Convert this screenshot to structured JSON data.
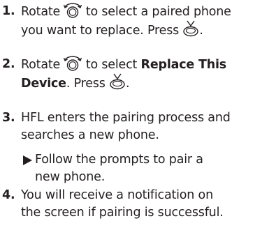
{
  "steps": [
    {
      "number": "1.",
      "line1_before": "Rotate",
      "line1_after": "to select a paired phone",
      "line2_before": "you want to replace. Press",
      "line2_after": ".",
      "icons": [
        "interface-dial-rotate-icon",
        "interface-dial-press-icon"
      ]
    },
    {
      "number": "2.",
      "line1_before": "Rotate",
      "line1_after": "to select",
      "line1_bold": "Replace This",
      "line2_bold": "Device",
      "line2_after": ". Press",
      "line2_end": ".",
      "icons": [
        "interface-dial-rotate-icon",
        "interface-dial-press-icon"
      ]
    },
    {
      "number": "3.",
      "line1": "HFL enters the pairing process and",
      "line2": "searches a new phone.",
      "substep": {
        "line1": "Follow the prompts to pair a",
        "line2": "new phone."
      }
    },
    {
      "number": "4.",
      "line1": "You will receive a notification on",
      "line2": "the screen if pairing is successful."
    }
  ]
}
